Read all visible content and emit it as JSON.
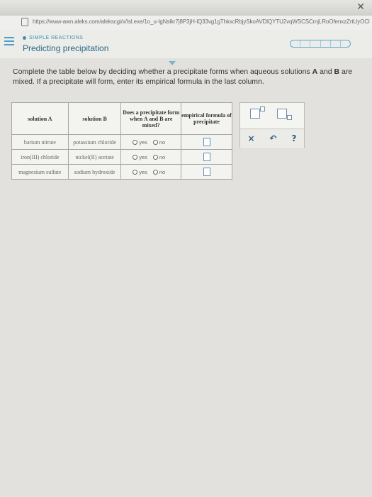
{
  "browser": {
    "url": "https://www-awn.aleks.com/alekscgi/x/Isl.exe/1o_u-IgNslkr7j8P3jH-lQ33vg1gThkxcRbjySkoAVDlQYTU2vqWSCSCmjLRoOfenxzZrtUyOClkbaSNrGsuEqHloemBWIOiltukwfFTE",
    "close_glyph": "✕"
  },
  "header": {
    "topic_sub": "SIMPLE REACTIONS",
    "topic_title": "Predicting precipitation",
    "progress_segments": 6
  },
  "instructions": {
    "part1": "Complete the table below by deciding whether a precipitate forms when aqueous solutions ",
    "a": "A",
    "and": " and ",
    "b": "B",
    "part2": " are mixed. If a precipitate will form, enter its empirical formula in the last column."
  },
  "table": {
    "headers": [
      "solution A",
      "solution B",
      "Does a precipitate form when A and B are mixed?",
      "empirical formula of precipitate"
    ],
    "rows": [
      {
        "a": "barium nitrate",
        "b": "potassium chloride"
      },
      {
        "a": "iron(III) chloride",
        "b": "nickel(II) acetate"
      },
      {
        "a": "magnesium sulfate",
        "b": "sodium hydroxide"
      }
    ],
    "options": {
      "yes": "yes",
      "no": "no"
    }
  },
  "tools": {
    "clear": "×",
    "undo": "↶",
    "help": "?"
  }
}
